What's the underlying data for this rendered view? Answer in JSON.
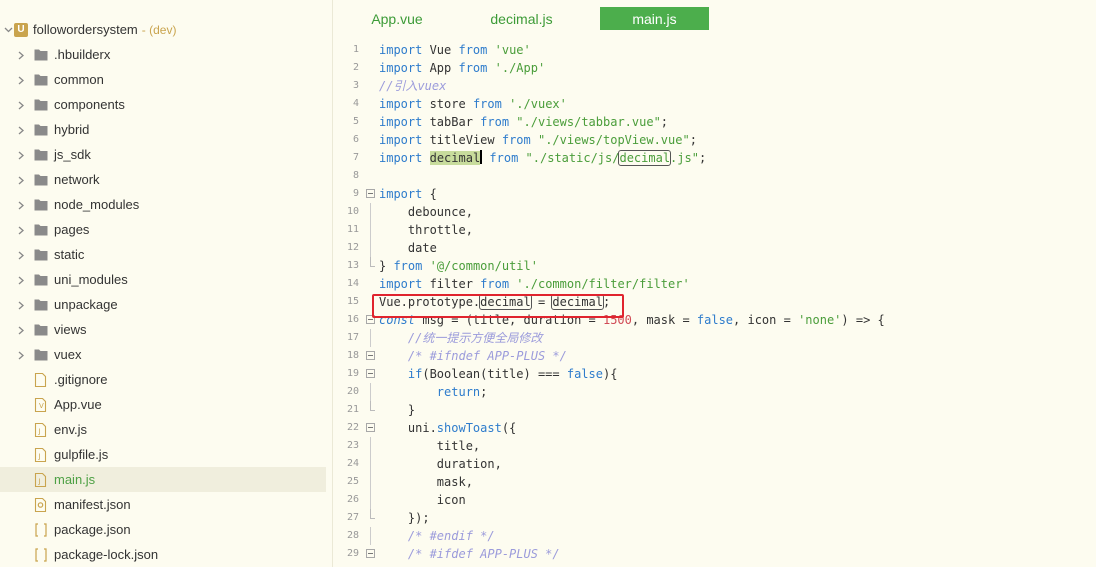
{
  "sidebar": {
    "project_name": "followordersystem",
    "project_tag": "- (dev)",
    "project_icon": "U",
    "items": [
      {
        "label": ".hbuilderx",
        "type": "folder"
      },
      {
        "label": "common",
        "type": "folder"
      },
      {
        "label": "components",
        "type": "folder"
      },
      {
        "label": "hybrid",
        "type": "folder"
      },
      {
        "label": "js_sdk",
        "type": "folder"
      },
      {
        "label": "network",
        "type": "folder"
      },
      {
        "label": "node_modules",
        "type": "folder"
      },
      {
        "label": "pages",
        "type": "folder"
      },
      {
        "label": "static",
        "type": "folder"
      },
      {
        "label": "uni_modules",
        "type": "folder"
      },
      {
        "label": "unpackage",
        "type": "folder"
      },
      {
        "label": "views",
        "type": "folder"
      },
      {
        "label": "vuex",
        "type": "folder"
      },
      {
        "label": ".gitignore",
        "type": "file-generic"
      },
      {
        "label": "App.vue",
        "type": "file-vue"
      },
      {
        "label": "env.js",
        "type": "file-js"
      },
      {
        "label": "gulpfile.js",
        "type": "file-js"
      },
      {
        "label": "main.js",
        "type": "file-js",
        "selected": true
      },
      {
        "label": "manifest.json",
        "type": "file-manifest"
      },
      {
        "label": "package.json",
        "type": "file-json"
      },
      {
        "label": "package-lock.json",
        "type": "file-json"
      }
    ]
  },
  "tabs": [
    {
      "label": "App.vue",
      "active": false
    },
    {
      "label": "decimal.js",
      "active": false
    },
    {
      "label": "main.js",
      "active": true
    }
  ],
  "colors": {
    "accent": "#4cae4c",
    "highlight_box": "#e0242e",
    "keyword": "#2e7ccc",
    "string": "#4a9d3a",
    "comment": "#9b9bdb"
  },
  "code": {
    "lines": [
      {
        "n": "1",
        "t": [
          [
            "kw",
            "import"
          ],
          [
            "",
            "Vue"
          ],
          [
            "kw",
            "from"
          ],
          [
            "str",
            "'vue'"
          ]
        ]
      },
      {
        "n": "2",
        "t": [
          [
            "kw",
            "import"
          ],
          [
            "",
            "App"
          ],
          [
            "kw",
            "from"
          ],
          [
            "str",
            "'./App'"
          ]
        ]
      },
      {
        "n": "3",
        "t": [
          [
            "cm",
            "//引入vuex"
          ]
        ]
      },
      {
        "n": "4",
        "t": [
          [
            "kw",
            "import"
          ],
          [
            "",
            "store"
          ],
          [
            "kw",
            "from"
          ],
          [
            "str",
            "'./vuex'"
          ]
        ]
      },
      {
        "n": "5",
        "t": [
          [
            "kw",
            "import"
          ],
          [
            "",
            "tabBar"
          ],
          [
            "kw",
            "from"
          ],
          [
            "str",
            "\"./views/tabbar.vue\""
          ],
          [
            "",
            ";"
          ]
        ]
      },
      {
        "n": "6",
        "t": [
          [
            "kw",
            "import"
          ],
          [
            "",
            "titleView"
          ],
          [
            "kw",
            "from"
          ],
          [
            "str",
            "\"./views/topView.vue\""
          ],
          [
            "",
            ";"
          ]
        ]
      },
      {
        "n": "7",
        "t": [
          [
            "kw",
            "import"
          ],
          [
            "",
            "decimal"
          ],
          [
            "kw",
            "from"
          ],
          [
            "str",
            "\"./static/js/decimal.js\""
          ],
          [
            "",
            ";"
          ]
        ]
      },
      {
        "n": "8",
        "t": []
      },
      {
        "n": "9",
        "t": [
          [
            "kw",
            "import"
          ],
          [
            "",
            "{"
          ]
        ]
      },
      {
        "n": "10",
        "t": [
          [
            "",
            "    debounce,"
          ]
        ]
      },
      {
        "n": "11",
        "t": [
          [
            "",
            "    throttle,"
          ]
        ]
      },
      {
        "n": "12",
        "t": [
          [
            "",
            "    date"
          ]
        ]
      },
      {
        "n": "13",
        "t": [
          [
            "",
            "}"
          ],
          [
            "kw",
            "from"
          ],
          [
            "str",
            "'@/common/util'"
          ]
        ]
      },
      {
        "n": "14",
        "t": [
          [
            "kw",
            "import"
          ],
          [
            "",
            "filter"
          ],
          [
            "kw",
            "from"
          ],
          [
            "str",
            "'./common/filter/filter'"
          ]
        ]
      },
      {
        "n": "15",
        "t": [
          [
            "",
            "Vue.prototype.decimal = decimal;"
          ]
        ]
      },
      {
        "n": "16",
        "t": [
          [
            "kwi",
            "const"
          ],
          [
            "",
            "msg = (title, duration = 1500, mask = false, icon = 'none') => {"
          ]
        ]
      },
      {
        "n": "17",
        "t": [
          [
            "cm",
            "    //统一提示方便全局修改"
          ]
        ]
      },
      {
        "n": "18",
        "t": [
          [
            "cm",
            "    /* #ifndef APP-PLUS */"
          ]
        ]
      },
      {
        "n": "19",
        "t": [
          [
            "",
            "    if(Boolean(title) === false){"
          ]
        ]
      },
      {
        "n": "20",
        "t": [
          [
            "",
            "        return;"
          ]
        ]
      },
      {
        "n": "21",
        "t": [
          [
            "",
            "    }"
          ]
        ]
      },
      {
        "n": "22",
        "t": [
          [
            "",
            "    uni.showToast({"
          ]
        ]
      },
      {
        "n": "23",
        "t": [
          [
            "",
            "        title,"
          ]
        ]
      },
      {
        "n": "24",
        "t": [
          [
            "",
            "        duration,"
          ]
        ]
      },
      {
        "n": "25",
        "t": [
          [
            "",
            "        mask,"
          ]
        ]
      },
      {
        "n": "26",
        "t": [
          [
            "",
            "        icon"
          ]
        ]
      },
      {
        "n": "27",
        "t": [
          [
            "",
            "    });"
          ]
        ]
      },
      {
        "n": "28",
        "t": [
          [
            "cm",
            "    /* #endif */"
          ]
        ]
      },
      {
        "n": "29",
        "t": [
          [
            "cm",
            "    /* #ifdef APP-PLUS */"
          ]
        ]
      }
    ]
  }
}
